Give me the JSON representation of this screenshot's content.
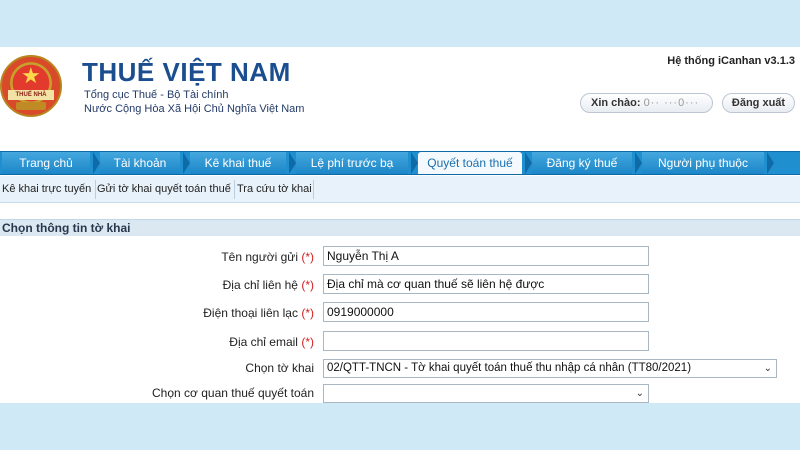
{
  "header": {
    "logo_text": "THUẾ NHÀ NƯỚC",
    "title": "THUẾ VIỆT NAM",
    "subtitle1": "Tổng cục Thuế - Bộ Tài chính",
    "subtitle2": "Nước Cộng Hòa Xã Hội Chủ Nghĩa Việt Nam",
    "system_version": "Hệ thống iCanhan v3.1.3",
    "greeting": "Xin chào:",
    "username_masked": "0·· ···0···",
    "logout_label": "Đăng xuất"
  },
  "nav": {
    "tabs": [
      {
        "label": "Trang chủ"
      },
      {
        "label": "Tài khoản"
      },
      {
        "label": "Kê khai thuế"
      },
      {
        "label": "Lệ phí trước bạ"
      },
      {
        "label": "Quyết toán thuế"
      },
      {
        "label": "Đăng ký thuế"
      },
      {
        "label": "Người phụ thuộc"
      }
    ],
    "active": "Quyết toán thuế"
  },
  "subnav": {
    "items": [
      {
        "label": "Kê khai trực tuyến"
      },
      {
        "label": "Gửi tờ khai quyết toán thuế"
      },
      {
        "label": "Tra cứu tờ khai"
      }
    ]
  },
  "form": {
    "section_title": "Chọn thông tin tờ khai",
    "required_mark": "(*)",
    "sender_name": {
      "label": "Tên người gửi",
      "value": "Nguyễn Thị  A"
    },
    "contact_address": {
      "label": "Địa chỉ liên hệ",
      "value": "Địa chỉ mà cơ quan thuế sẽ liên hệ được"
    },
    "phone": {
      "label": "Điện thoại liên lạc",
      "value": "0919000000"
    },
    "email": {
      "label": "Địa chỉ email",
      "value": ""
    },
    "declaration": {
      "label": "Chọn tờ khai",
      "value": "02/QTT-TNCN - Tờ khai quyết toán thuế thu nhập cá nhân (TT80/2021)"
    },
    "tax_office": {
      "label": "Chọn cơ quan thuế quyết toán",
      "value": ""
    }
  },
  "colors": {
    "brand": "#1b4e8f",
    "nav_bg": "#1f8fd0",
    "background": "#cfe9f6",
    "required": "#d21f1f"
  }
}
